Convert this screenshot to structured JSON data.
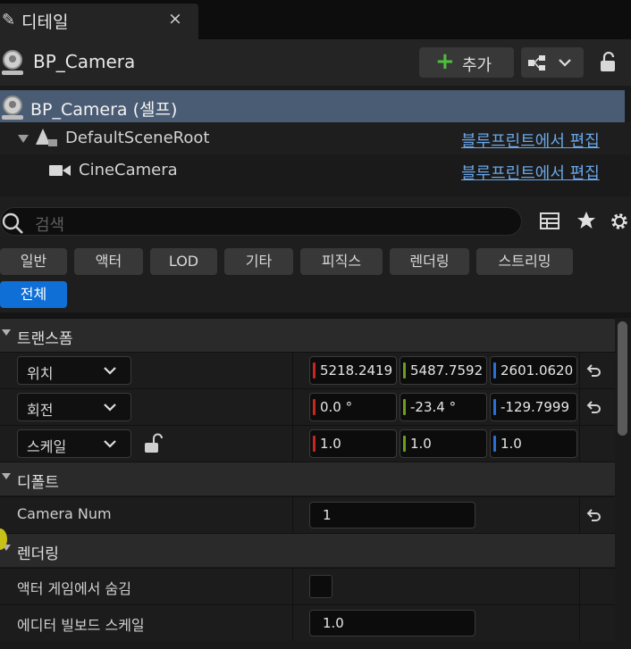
{
  "tab": {
    "title": "디테일",
    "close": "×"
  },
  "header": {
    "title": "BP_Camera",
    "add_label": "추가",
    "add_plus": "+"
  },
  "tree": {
    "self": "BP_Camera (셀프)",
    "root": "DefaultSceneRoot",
    "camera": "CineCamera",
    "edit_link": "블루프린트에서 편집"
  },
  "search": {
    "placeholder": "검색"
  },
  "categories": [
    "일반",
    "액터",
    "LOD",
    "기타",
    "피직스",
    "렌더링",
    "스트리밍",
    "전체"
  ],
  "sections": {
    "transform": "트랜스폼",
    "default": "디폴트",
    "rendering": "렌더링"
  },
  "transform": {
    "location": {
      "label": "위치",
      "x": "5218.2419",
      "y": "5487.7592",
      "z": "2601.0620"
    },
    "rotation": {
      "label": "회전",
      "x": "0.0 °",
      "y": "-23.4 °",
      "z": "-129.7999"
    },
    "scale": {
      "label": "스케일",
      "x": "1.0",
      "y": "1.0",
      "z": "1.0"
    }
  },
  "default_props": {
    "camera_num_label": "Camera Num",
    "camera_num_value": "1"
  },
  "rendering_props": {
    "hide_in_game_label": "액터 게임에서 숨김",
    "billboard_scale_label": "에디터 빌보드 스케일",
    "billboard_scale_value": "1.0"
  },
  "colors": {
    "x_axis": "#c8271e",
    "y_axis": "#6a9e1f",
    "z_axis": "#2a6fd6",
    "accent": "#0f6fd6",
    "selection": "#4a5c74"
  }
}
